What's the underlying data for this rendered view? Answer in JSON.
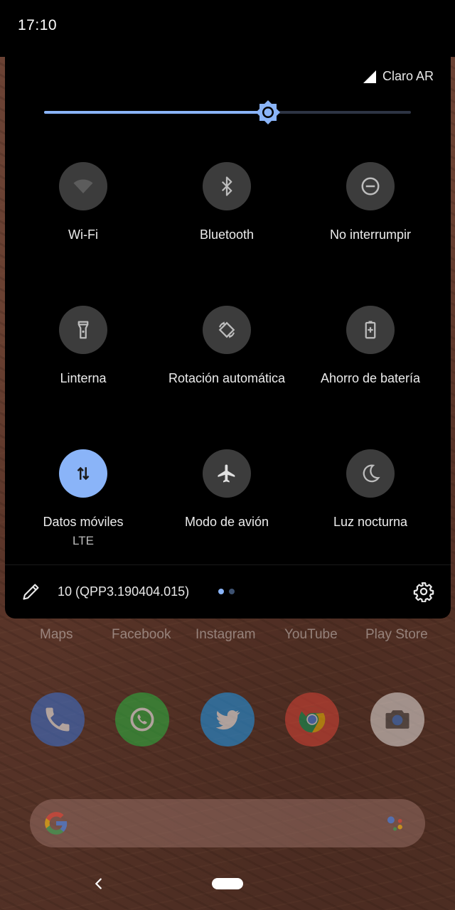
{
  "status_bar": {
    "time": "17:10"
  },
  "carrier": {
    "name": "Claro AR"
  },
  "brightness": {
    "level": 0.61
  },
  "tiles": [
    {
      "label": "Wi-Fi",
      "icon": "wifi-icon",
      "active": false
    },
    {
      "label": "Bluetooth",
      "icon": "bluetooth-icon",
      "active": false
    },
    {
      "label": "No interrumpir",
      "icon": "do-not-disturb-icon",
      "active": false
    },
    {
      "label": "Linterna",
      "icon": "flashlight-icon",
      "active": false
    },
    {
      "label": "Rotación automática",
      "icon": "auto-rotate-icon",
      "active": false
    },
    {
      "label": "Ahorro de batería",
      "icon": "battery-saver-icon",
      "active": false
    },
    {
      "label": "Datos móviles",
      "sublabel": "LTE",
      "icon": "mobile-data-icon",
      "active": true
    },
    {
      "label": "Modo de avión",
      "icon": "airplane-icon",
      "active": false
    },
    {
      "label": "Luz nocturna",
      "icon": "night-light-icon",
      "active": false
    }
  ],
  "footer": {
    "build": "10 (QPP3.190404.015)",
    "page_dots": {
      "total": 2,
      "current": 1
    },
    "edit_icon": "pencil-icon",
    "settings_icon": "gear-icon"
  },
  "home": {
    "app_labels": [
      "Maps",
      "Facebook",
      "Instagram",
      "YouTube",
      "Play Store"
    ],
    "dock": [
      "phone-icon",
      "whatsapp-icon",
      "twitter-icon",
      "chrome-icon",
      "camera-icon"
    ]
  },
  "colors": {
    "accent": "#8ab4f8",
    "tile_inactive": "#3c3c3c",
    "panel": "#000000"
  }
}
